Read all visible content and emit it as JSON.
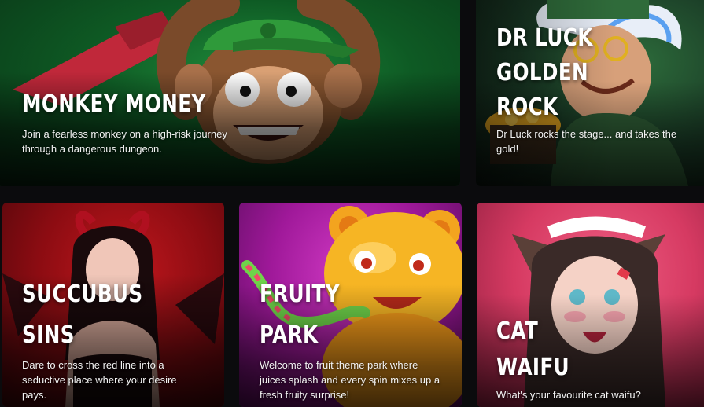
{
  "games": [
    {
      "title_lines": [
        "Monkey Money"
      ],
      "description": "Join a fearless monkey on a high-risk journey through a dangerous dungeon."
    },
    {
      "title_lines": [
        "Dr Luck",
        "Golden",
        "Rock"
      ],
      "description": "Dr Luck rocks the stage... and takes the gold!"
    },
    {
      "title_lines": [
        "Succubus",
        "Sins"
      ],
      "description": "Dare to cross the red line into a seductive place where your desire pays."
    },
    {
      "title_lines": [
        "Fruity",
        "Park"
      ],
      "description": "Welcome to fruit theme park where juices splash and every spin mixes up a fresh fruity surprise!"
    },
    {
      "title_lines": [
        "Cat",
        "Waifu"
      ],
      "description": "What's your favourite cat waifu?"
    }
  ],
  "colors": {
    "page_background": "#0b0b0d",
    "monkey_card": "#0e5a24",
    "dr_luck_card": "#1a3b26",
    "succubus_card": "#8c0c12",
    "fruity_card": "#a0199a",
    "cat_card": "#d63a62"
  },
  "artwork": [
    "monkey-artwork",
    "dr-luck-artwork",
    "succubus-artwork",
    "gummy-bear-artwork",
    "cat-girl-artwork"
  ]
}
